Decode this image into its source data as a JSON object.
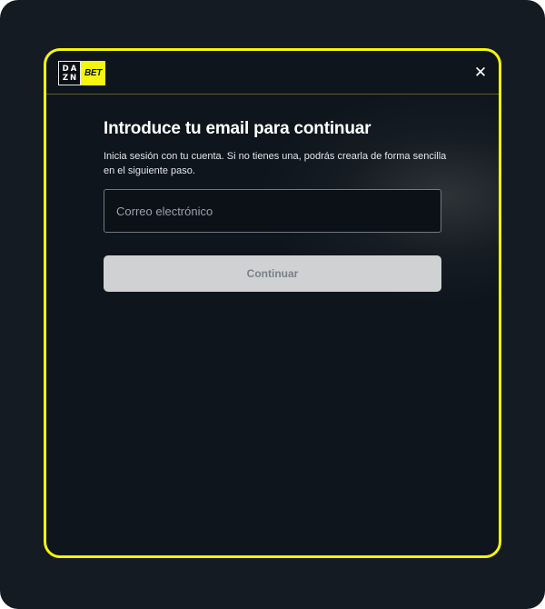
{
  "logo": {
    "dazn_line1": "DA",
    "dazn_line2": "ZN",
    "bet": "BET"
  },
  "header": {
    "close_icon": "close-icon",
    "close_glyph": "✕"
  },
  "login": {
    "title": "Introduce tu email para continuar",
    "subtitle": "Inicia sesión con tu cuenta. Si no tienes una, podrás crearla de forma sencilla en el siguiente paso.",
    "email_placeholder": "Correo electrónico",
    "email_value": "",
    "continue_label": "Continuar"
  },
  "colors": {
    "accent": "#f5f60b",
    "background": "#141b23",
    "modal_background": "#0e151c",
    "button_disabled": "#cfd1d3"
  }
}
